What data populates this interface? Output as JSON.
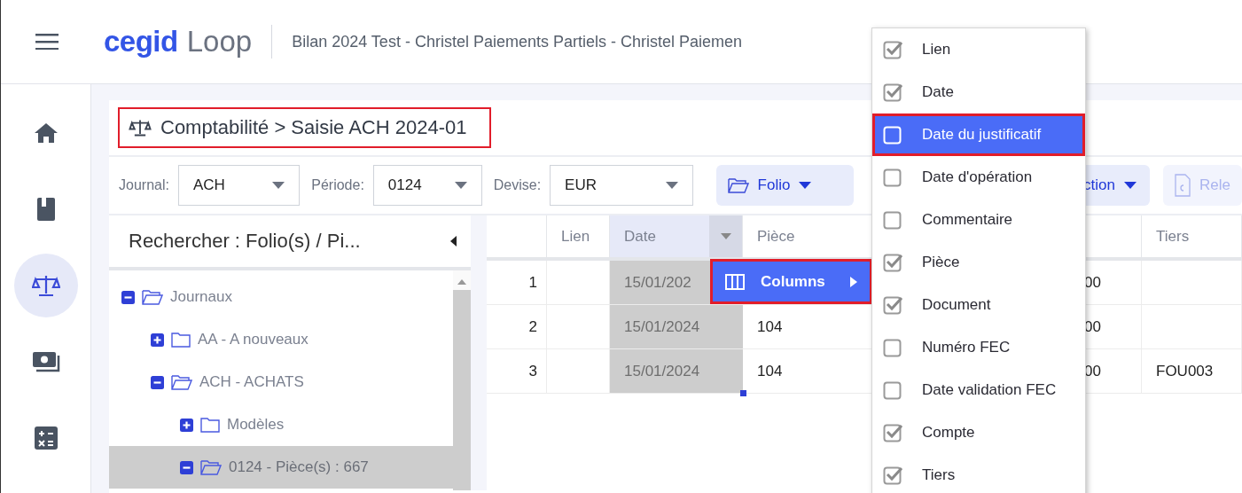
{
  "header": {
    "logo_bold": "cegid",
    "logo_light": "Loop",
    "title": "Bilan 2024 Test - Christel Paiements Partiels - Christel Paiemen"
  },
  "sidebar": {
    "items": [
      {
        "selected": false
      },
      {
        "selected": false
      },
      {
        "selected": true
      },
      {
        "selected": false
      },
      {
        "selected": false
      }
    ]
  },
  "breadcrumb": {
    "text": "Comptabilité > Saisie ACH 2024-01",
    "outlined": true
  },
  "toolbar": {
    "fields": [
      {
        "label": "Journal:",
        "value": "ACH"
      },
      {
        "label": "Période:",
        "value": "0124"
      },
      {
        "label": "Devise:",
        "value": "EUR"
      }
    ],
    "buttons": [
      {
        "label": "Folio",
        "kind": "folder",
        "disabled": false
      },
      {
        "label": "ction",
        "kind": "plain",
        "disabled": false
      },
      {
        "label": "Rele",
        "kind": "document",
        "disabled": true
      }
    ]
  },
  "tree": {
    "title": "Rechercher : Folio(s) / Pi...",
    "items": [
      {
        "label": "Journaux",
        "expanded": true,
        "selected": false,
        "children": [
          {
            "label": "AA - A nouveaux",
            "expanded": false,
            "selected": false
          },
          {
            "label": "ACH - ACHATS",
            "expanded": true,
            "selected": false,
            "children": [
              {
                "label": "Modèles",
                "expanded": false,
                "selected": false
              },
              {
                "label": "0124 - Pièce(s) : 667",
                "expanded": true,
                "selected": true
              }
            ]
          }
        ]
      }
    ]
  },
  "grid": {
    "headers": {
      "lien": "Lien",
      "date": "Date",
      "piece": "Pièce",
      "tiers": "Tiers"
    },
    "date_menu_open": true,
    "rows": [
      {
        "number": "1",
        "date": "15/01/202",
        "column_5": "00"
      },
      {
        "number": "2",
        "date": "15/01/2024",
        "piece": "104",
        "column_5": "00"
      },
      {
        "number": "3",
        "date": "15/01/2024",
        "piece": "104",
        "column_5": "00",
        "tiers": "FOU003"
      }
    ]
  },
  "column_menu": {
    "label": "Columns",
    "outlined": true
  },
  "column_chooser": {
    "items": [
      {
        "label": "Lien",
        "checked": true,
        "highlighted": false,
        "outlined": false
      },
      {
        "label": "Date",
        "checked": true,
        "highlighted": false,
        "outlined": false
      },
      {
        "label": "Date du justificatif",
        "checked": false,
        "highlighted": true,
        "outlined": true
      },
      {
        "label": "Date d'opération",
        "checked": false,
        "highlighted": false,
        "outlined": false
      },
      {
        "label": "Commentaire",
        "checked": false,
        "highlighted": false,
        "outlined": false
      },
      {
        "label": "Pièce",
        "checked": true,
        "highlighted": false,
        "outlined": false
      },
      {
        "label": "Document",
        "checked": true,
        "highlighted": false,
        "outlined": false
      },
      {
        "label": "Numéro FEC",
        "checked": false,
        "highlighted": false,
        "outlined": false
      },
      {
        "label": "Date validation FEC",
        "checked": false,
        "highlighted": false,
        "outlined": false
      },
      {
        "label": "Compte",
        "checked": true,
        "highlighted": false,
        "outlined": false
      },
      {
        "label": "Tiers",
        "checked": true,
        "highlighted": false,
        "outlined": false
      }
    ]
  }
}
